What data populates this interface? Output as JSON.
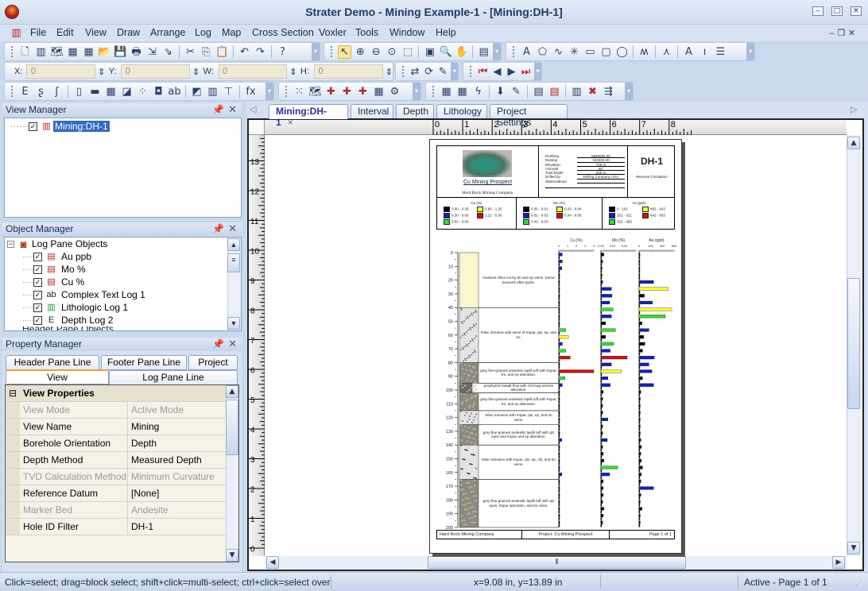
{
  "window": {
    "title": "Strater Demo - Mining Example-1 - [Mining:DH-1]",
    "min": "‒",
    "max": "□",
    "close": "✕"
  },
  "menu": [
    "File",
    "Edit",
    "View",
    "Draw",
    "Arrange",
    "Log",
    "Map",
    "Cross Section",
    "Voxler",
    "Tools",
    "Window",
    "Help"
  ],
  "toolbar1": [
    [
      "new-icon",
      "🗋"
    ],
    [
      "new-borehole-icon",
      "▥"
    ],
    [
      "new-map-icon",
      "🗺"
    ],
    [
      "new-cross-section-icon",
      "▦"
    ],
    [
      "new-table-icon",
      "▦"
    ],
    [
      "open-icon",
      "📂"
    ],
    [
      "save-icon",
      "💾"
    ],
    [
      "print-icon",
      "🖶"
    ],
    [
      "import-icon",
      "⇲"
    ],
    [
      "export-icon",
      "⇘"
    ],
    [
      "|",
      ""
    ],
    [
      "cut-icon",
      "✂"
    ],
    [
      "copy-icon",
      "⎘"
    ],
    [
      "paste-icon",
      "📋"
    ],
    [
      "|",
      ""
    ],
    [
      "undo-icon",
      "↶"
    ],
    [
      "redo-icon",
      "↷"
    ],
    [
      "|",
      ""
    ],
    [
      "help-icon",
      "?"
    ]
  ],
  "toolbar2": [
    [
      "select-icon",
      "↖"
    ],
    [
      "zoom-in-icon",
      "⊕"
    ],
    [
      "zoom-out-icon",
      "⊖"
    ],
    [
      "zoom-fit-icon",
      "⊙"
    ],
    [
      "zoom-rect-icon",
      "⬚"
    ],
    [
      "|",
      ""
    ],
    [
      "zoom-page-icon",
      "▣"
    ],
    [
      "zoom-selected-icon",
      "🔍"
    ],
    [
      "pan-icon",
      "✋"
    ],
    [
      "|",
      ""
    ],
    [
      "properties-icon",
      "▤"
    ]
  ],
  "toolbar3": [
    [
      "text-icon",
      "A"
    ],
    [
      "polygon-icon",
      "⬠"
    ],
    [
      "polyline-icon",
      "∿"
    ],
    [
      "symbol-icon",
      "✳"
    ],
    [
      "rectangle-icon",
      "▭"
    ],
    [
      "rounded-rectangle-icon",
      "▢"
    ],
    [
      "ellipse-icon",
      "◯"
    ],
    [
      "|",
      ""
    ],
    [
      "spline-icon",
      "ʍ"
    ],
    [
      "|",
      ""
    ],
    [
      "well-symbol-icon",
      "⋏"
    ],
    [
      "|",
      ""
    ],
    [
      "text-link-icon",
      "A"
    ],
    [
      "scale-bar-icon",
      "ı"
    ],
    [
      "legend-icon",
      "☰"
    ]
  ],
  "coords": {
    "x_label": "X:",
    "x_value": "0",
    "y_label": "Y:",
    "y_value": "0",
    "w_label": "W:",
    "w_value": "0",
    "h_label": "H:",
    "h_value": "0"
  },
  "toolbar4": [
    [
      "reload-data-icon",
      "⇄"
    ],
    [
      "refresh-icon",
      "⟳"
    ],
    [
      "edit-icon",
      "✎"
    ]
  ],
  "toolbar5": [
    [
      "first-icon",
      "⏮"
    ],
    [
      "previous-icon",
      "◀"
    ],
    [
      "next-icon",
      "▶"
    ],
    [
      "last-icon",
      "⏭"
    ]
  ],
  "toolbar6": [
    [
      "depth-log-icon",
      "E"
    ],
    [
      "line-log-icon",
      "ʂ"
    ],
    [
      "crossplot-log-icon",
      "ʃ"
    ],
    [
      "|",
      ""
    ],
    [
      "zone-bar-log-icon",
      "▯"
    ],
    [
      "bar-log-icon",
      "▬"
    ],
    [
      "percentage-log-icon",
      "▦"
    ],
    [
      "post-log-icon",
      "◪"
    ],
    [
      "symbol-log-icon",
      "⁘"
    ],
    [
      "well-construction-log-icon",
      "◘"
    ],
    [
      "complex-text-log-icon",
      "ab"
    ],
    [
      "|",
      ""
    ],
    [
      "image-log-icon",
      "◩"
    ],
    [
      "lithologic-log-icon",
      "▥"
    ],
    [
      "tadpole-log-icon",
      "⊤"
    ],
    [
      "|",
      ""
    ],
    [
      "function-log-icon",
      "fx"
    ]
  ],
  "toolbar7": [
    [
      "post-map-icon",
      "⁙"
    ],
    [
      "base-map-icon",
      "🗺"
    ],
    [
      "add-well-icon",
      "✚"
    ],
    [
      "add-map-well-icon",
      "✚"
    ],
    [
      "add-cross-section-icon",
      "✚"
    ],
    [
      "cross-section-icon",
      "▦"
    ],
    [
      "settings-icon",
      "⚙"
    ]
  ],
  "toolbar8": [
    [
      "table-icon",
      "▦"
    ],
    [
      "table-select-icon",
      "▦"
    ],
    [
      "table-calc-icon",
      "ϟ"
    ],
    [
      "|",
      ""
    ],
    [
      "import-table-icon",
      "⬇"
    ],
    [
      "edit-table-icon",
      "✎"
    ],
    [
      "|",
      ""
    ],
    [
      "insert-row-icon",
      "▤"
    ],
    [
      "delete-row-icon",
      "▤"
    ],
    [
      "|",
      ""
    ],
    [
      "insert-column-icon",
      "▥"
    ],
    [
      "delete-column-icon",
      "✖"
    ],
    [
      "merge-icon",
      "⇶"
    ]
  ],
  "view_manager": {
    "title": "View Manager",
    "items": [
      {
        "label": "Mining:DH-1",
        "checked": true
      }
    ]
  },
  "object_manager": {
    "title": "Object Manager",
    "root": "Log Pane Objects",
    "items": [
      {
        "label": "Au ppb",
        "icon": "bar-log-icon"
      },
      {
        "label": "Mo %",
        "icon": "bar-log-icon"
      },
      {
        "label": "Cu %",
        "icon": "bar-log-icon"
      },
      {
        "label": "Complex Text Log 1",
        "icon": "complex-text-log-icon"
      },
      {
        "label": "Lithologic Log 1",
        "icon": "lithologic-log-icon"
      },
      {
        "label": "Depth Log 2",
        "icon": "depth-log-icon"
      }
    ],
    "partial": "Header Pane Objects"
  },
  "property_manager": {
    "title": "Property Manager",
    "tabs_row1": [
      "Header Pane Line",
      "Footer Pane Line",
      "Project"
    ],
    "tabs_row2": [
      "View",
      "Log Pane Line"
    ],
    "active_tab": "View",
    "section": "View Properties",
    "rows": [
      {
        "k": "View Mode",
        "v": "Active Mode",
        "disabled": true
      },
      {
        "k": "View Name",
        "v": "Mining"
      },
      {
        "k": "Borehole Orientation",
        "v": "Depth"
      },
      {
        "k": "Depth Method",
        "v": "Measured Depth"
      },
      {
        "k": "TVD Calculation Method",
        "v": "Minimum Curvature",
        "disabled": true
      },
      {
        "k": "Reference Datum",
        "v": "[None]"
      },
      {
        "k": "Marker Bed",
        "v": "Andesite",
        "disabled": true
      },
      {
        "k": "Hole ID Filter",
        "v": "DH-1"
      }
    ]
  },
  "doc_tabs": [
    {
      "label": "Mining:DH-1",
      "active": true,
      "close": "×"
    },
    {
      "label": "Interval"
    },
    {
      "label": "Depth"
    },
    {
      "label": "Lithology"
    },
    {
      "label": "Project Settings"
    }
  ],
  "ruler": {
    "top": [
      "0",
      "1",
      "2",
      "3",
      "4",
      "5",
      "6",
      "7",
      "8"
    ],
    "left": [
      "13",
      "12",
      "11",
      "10",
      "9",
      "8",
      "7",
      "6",
      "5",
      "4",
      "3",
      "2",
      "1",
      "0"
    ]
  },
  "page": {
    "header": {
      "project_link": "Cu Mining Prospect",
      "company": "Hard Rock Mining Company",
      "hole_id": "DH-1",
      "method": "Reverse Circulation",
      "fields": [
        [
          "Northing",
          "6666666.00"
        ],
        [
          "Easting",
          "333333.00"
        ],
        [
          "Elevation:",
          "745 m"
        ],
        [
          "Azimuth",
          "40°"
        ],
        [
          "Total Depth",
          "200 m"
        ],
        [
          "Drilled by:",
          "Drilling Company USA"
        ],
        [
          "Observations:",
          ""
        ]
      ]
    },
    "legends": [
      {
        "title": "Cu (%)",
        "bins": [
          [
            "0.00 - 0.30",
            "#000000"
          ],
          [
            "0.30 - 0.60",
            "#1020c0"
          ],
          [
            "0.60 - 0.90",
            "#30e030"
          ],
          [
            "0.90 - 1.20",
            "#ffff20"
          ],
          [
            "1.21 - 5.00",
            "#d01010"
          ]
        ]
      },
      {
        "title": "Mo (%)",
        "bins": [
          [
            "0.00 - 0.01",
            "#000000"
          ],
          [
            "0.01 - 0.02",
            "#1020c0"
          ],
          [
            "0.02 - 0.03",
            "#30e030"
          ],
          [
            "0.03 - 0.04",
            "#ffff20"
          ],
          [
            "0.04 - 0.05",
            "#d01010"
          ]
        ]
      },
      {
        "title": "Au (ppb)",
        "bins": [
          [
            "0 - 161",
            "#000000"
          ],
          [
            "161 - 321",
            "#1020c0"
          ],
          [
            "321 - 482",
            "#30e030"
          ],
          [
            "482 - 642",
            "#ffff20"
          ],
          [
            "642 - 803",
            "#d01010"
          ]
        ]
      }
    ],
    "depth_ticks": [
      "0",
      "10",
      "20",
      "30",
      "40",
      "50",
      "60",
      "70",
      "80",
      "90",
      "100",
      "110",
      "120",
      "130",
      "140",
      "150",
      "160",
      "170",
      "180",
      "190",
      "200"
    ],
    "lithology": [
      {
        "from": 0,
        "to": 40,
        "type": "silica",
        "color": "#fbf7cf",
        "desc": "massive silica cut by tm and ep veins. Some boxwork after pyrite."
      },
      {
        "from": 40,
        "to": 80,
        "type": "felsic",
        "color": "#e4e4e4",
        "desc": "felsic intrusive with veins of Kspar, qtz, ep, and tm."
      },
      {
        "from": 80,
        "to": 95,
        "type": "andesite",
        "color": "#8a8a82",
        "desc": "grey fine-grained andesitic lapilli tuff with Kspar, tm, and ep alteration."
      },
      {
        "from": 95,
        "to": 102,
        "type": "basalt",
        "color": "#6a6a6a",
        "desc": "porphyritic basalt flow with chl-mag-sericite alteration."
      },
      {
        "from": 102,
        "to": 115,
        "type": "andesite",
        "color": "#8a8a82",
        "desc": "grey fine-grained andesitic lapilli tuff with Kspar, tm, and ep alteration."
      },
      {
        "from": 115,
        "to": 125,
        "type": "felsic",
        "color": "#e4e4e4",
        "desc": "felsic intrusive with Kspar, qtz, ep, and tm veins."
      },
      {
        "from": 125,
        "to": 140,
        "type": "andesite",
        "color": "#8a8a82",
        "desc": "grey fine-grained andesitic lapilli tuff with qtz eyes and Kspar and ep alteration."
      },
      {
        "from": 140,
        "to": 165,
        "type": "felsic",
        "color": "#e4e4e4",
        "desc": "felsic intrusive with Kspar, qtz, ep, chl, and tm veins."
      },
      {
        "from": 165,
        "to": 200,
        "type": "andesite",
        "color": "#8a8a82",
        "desc": "grey fine-grained andesitic lapilli tuff with qtz eyes, Kspar alteration, and tm veins."
      }
    ],
    "tracks": [
      {
        "title": "Cu (%)",
        "ticks": [
          "0",
          "1",
          "2",
          "3",
          "4"
        ],
        "max": 4,
        "thresholds": [
          0.3,
          0.6,
          0.9,
          1.2
        ],
        "values": [
          0.4,
          0.4,
          0.35,
          0.1,
          0.1,
          0.1,
          0.1,
          0.1,
          0.1,
          0.1,
          0.1,
          0.8,
          1.1,
          0.4,
          0.8,
          1.3,
          0.1,
          4.0,
          0.7,
          0.4,
          0.1,
          0.1,
          0.1,
          0.1,
          0.1,
          0.1,
          0.1,
          0.35,
          0.1,
          0.1,
          0.1,
          0.1,
          0.35,
          0.1,
          0.1,
          0.1,
          0.1,
          0.1,
          0.1,
          0.1
        ]
      },
      {
        "title": "Mo (%)",
        "ticks": [
          "0.00",
          "0.02",
          "0.04"
        ],
        "max": 0.06,
        "thresholds": [
          0.01,
          0.02,
          0.03,
          0.04
        ],
        "values": [
          0.005,
          0.003,
          0.002,
          0.002,
          0.003,
          0.018,
          0.019,
          0.015,
          0.021,
          0.018,
          0.008,
          0.025,
          0.008,
          0.022,
          0.016,
          0.045,
          0.018,
          0.035,
          0.012,
          0.016,
          0.004,
          0.003,
          0.003,
          0.003,
          0.012,
          0.003,
          0.003,
          0.011,
          0.003,
          0.004,
          0.005,
          0.029,
          0.015,
          0.004,
          0.004,
          0.004,
          0.003,
          0.005,
          0.004,
          0.003
        ]
      },
      {
        "title": "Au (ppb)",
        "ticks": [
          "0",
          "200",
          "400",
          "600"
        ],
        "max": 600,
        "thresholds": [
          161,
          321,
          482,
          642
        ],
        "values": [
          15,
          8,
          5,
          5,
          250,
          500,
          90,
          230,
          560,
          450,
          50,
          170,
          80,
          100,
          60,
          260,
          170,
          220,
          60,
          250,
          30,
          20,
          20,
          20,
          20,
          20,
          20,
          30,
          40,
          30,
          40,
          60,
          40,
          30,
          250,
          30,
          20,
          50,
          20,
          20
        ]
      }
    ],
    "footer": [
      "Hard Rock Mining Company",
      "Project: Cu Mining Prospect",
      "Page 1 of 1"
    ]
  },
  "status": {
    "hint": "Click=select; drag=block select; shift+click=multi-select; ctrl+click=select overla",
    "coords": "x=9.08 in, y=13.89 in",
    "state": "Active - Page 1 of 1"
  }
}
